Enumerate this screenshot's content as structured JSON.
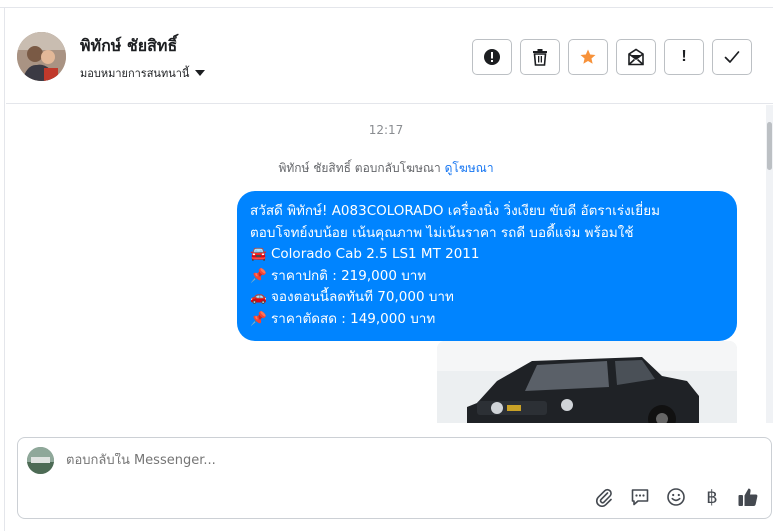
{
  "contact": {
    "name": "พิทักษ์ ชัยสิทธิ์",
    "assign_label": "มอบหมายการสนทนานี้"
  },
  "actions": [
    {
      "name": "spam-button",
      "icon": "alert-circle-icon"
    },
    {
      "name": "delete-button",
      "icon": "trash-icon"
    },
    {
      "name": "star-button",
      "icon": "star-icon",
      "color": "#f7923a"
    },
    {
      "name": "mark-unread-button",
      "icon": "envelope-icon"
    },
    {
      "name": "follow-up-button",
      "icon": "exclamation-icon",
      "text": "!"
    },
    {
      "name": "mark-done-button",
      "icon": "check-icon"
    }
  ],
  "chat": {
    "time": "12:17",
    "reply_note": "พิทักษ์ ชัยสิทธิ์ ตอบกลับโฆษณา",
    "reply_link": "ดูโฆษณา",
    "message_lines": [
      {
        "emoji": "",
        "text": "สวัสดี พิทักษ์! A083COLORADO เครื่องนิ่ง วิ่งเงียบ ขับดี อัตราเร่งเยี่ยม"
      },
      {
        "emoji": "",
        "text": "ตอบโจทย์งบน้อย เน้นคุณภาพ ไม่เน้นราคา รถดี บอดี้แจ่ม พร้อมใช้"
      },
      {
        "emoji": "🚘",
        "text": "Colorado Cab 2.5 LS1 MT 2011"
      },
      {
        "emoji": "📌",
        "text": "ราคาปกติ : 219,000 บาท"
      },
      {
        "emoji": "🚗",
        "text": "จองตอนนี้ลดทันที 70,000 บาท"
      },
      {
        "emoji": "📌",
        "text": "ราคาตัดสด : 149,000 บาท"
      }
    ],
    "bubble_color": "#0084ff"
  },
  "composer": {
    "placeholder": "ตอบกลับใน Messenger...",
    "tools": [
      "paperclip-icon",
      "comment-icon",
      "smiley-icon",
      "baht-icon",
      "thumbs-up-icon"
    ],
    "baht_symbol": "฿"
  }
}
